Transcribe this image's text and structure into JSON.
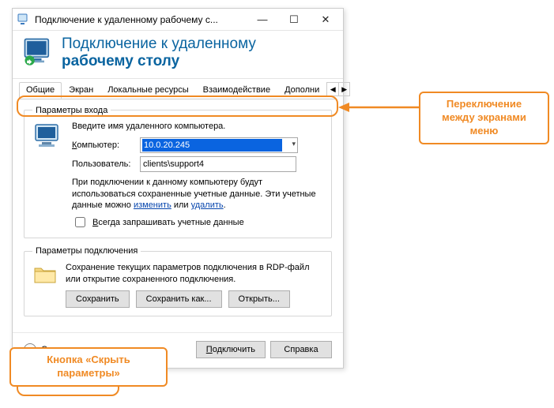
{
  "titlebar": {
    "text": "Подключение к удаленному рабочему с..."
  },
  "header": {
    "line1": "Подключение к удаленному",
    "line2": "рабочему столу"
  },
  "tabs": {
    "t1": "Общие",
    "t2": "Экран",
    "t3": "Локальные ресурсы",
    "t4": "Взаимодействие",
    "t5": "Дополни"
  },
  "login_group": {
    "legend": "Параметры входа",
    "intro": "Введите имя удаленного компьютера.",
    "computer_label": "Компьютер:",
    "computer_value": "10.0.20.245",
    "user_label": "Пользователь:",
    "user_value": "clients\\support4",
    "note_a": "При подключении к данному компьютеру будут использоваться сохраненные учетные данные.  Эти учетные данные можно ",
    "link_edit": "изменить",
    "or": " или ",
    "link_delete": "удалить",
    "dot": ".",
    "always_label": "Всегда запрашивать учетные данные"
  },
  "conn_group": {
    "legend": "Параметры подключения",
    "desc": "Сохранение текущих параметров подключения в RDP-файл или открытие сохраненного подключения.",
    "save": "Сохранить",
    "save_as": "Сохранить как...",
    "open": "Открыть..."
  },
  "footer": {
    "hide": "Скрыть параметры",
    "connect": "Подключить",
    "help": "Справка"
  },
  "callouts": {
    "tabs": "Переключение между экранами меню",
    "hide": "Кнопка «Скрыть параметры»"
  }
}
